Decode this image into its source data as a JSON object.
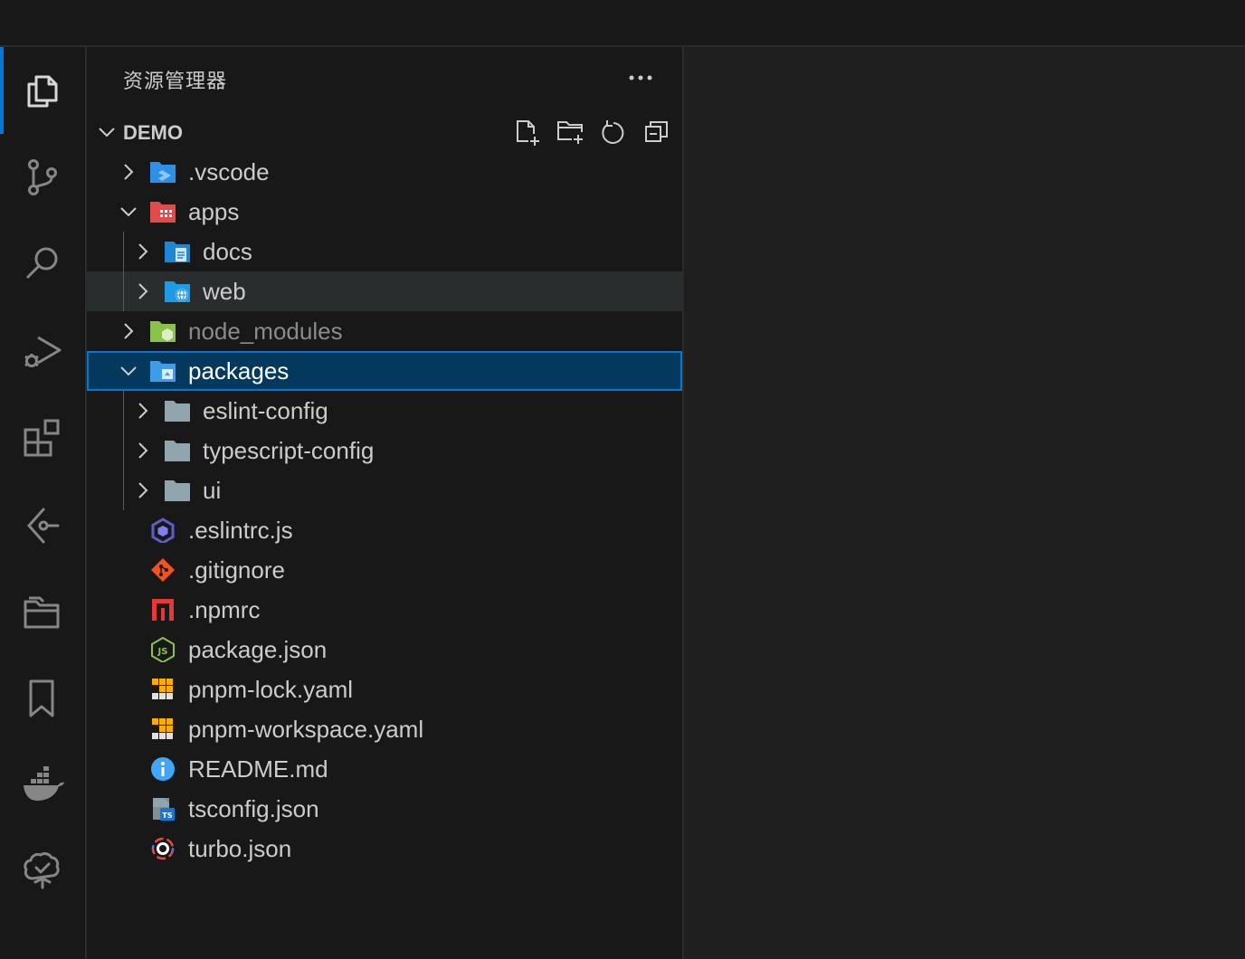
{
  "explorer": {
    "title": "资源管理器",
    "more_actions_icon": "ellipsis-icon",
    "section": {
      "label": "DEMO",
      "actions": [
        "new-file-icon",
        "new-folder-icon",
        "refresh-icon",
        "collapse-all-icon"
      ]
    },
    "tree": [
      {
        "label": ".vscode",
        "type": "folder",
        "expanded": false,
        "depth": 0,
        "icon": "vscode-folder-icon",
        "state": ""
      },
      {
        "label": "apps",
        "type": "folder",
        "expanded": true,
        "depth": 0,
        "icon": "apps-folder-icon",
        "state": ""
      },
      {
        "label": "docs",
        "type": "folder",
        "expanded": false,
        "depth": 1,
        "icon": "docs-folder-icon",
        "state": ""
      },
      {
        "label": "web",
        "type": "folder",
        "expanded": false,
        "depth": 1,
        "icon": "web-folder-icon",
        "state": "hover"
      },
      {
        "label": "node_modules",
        "type": "folder",
        "expanded": false,
        "depth": 0,
        "icon": "node-modules-folder-icon",
        "state": "dimmed"
      },
      {
        "label": "packages",
        "type": "folder",
        "expanded": true,
        "depth": 0,
        "icon": "packages-folder-icon",
        "state": "selected"
      },
      {
        "label": "eslint-config",
        "type": "folder",
        "expanded": false,
        "depth": 1,
        "icon": "folder-icon",
        "state": ""
      },
      {
        "label": "typescript-config",
        "type": "folder",
        "expanded": false,
        "depth": 1,
        "icon": "folder-icon",
        "state": ""
      },
      {
        "label": "ui",
        "type": "folder",
        "expanded": false,
        "depth": 1,
        "icon": "folder-icon",
        "state": ""
      },
      {
        "label": ".eslintrc.js",
        "type": "file",
        "depth": 0,
        "icon": "eslint-icon",
        "state": ""
      },
      {
        "label": ".gitignore",
        "type": "file",
        "depth": 0,
        "icon": "git-icon",
        "state": ""
      },
      {
        "label": ".npmrc",
        "type": "file",
        "depth": 0,
        "icon": "npm-icon",
        "state": ""
      },
      {
        "label": "package.json",
        "type": "file",
        "depth": 0,
        "icon": "nodejs-icon",
        "state": ""
      },
      {
        "label": "pnpm-lock.yaml",
        "type": "file",
        "depth": 0,
        "icon": "pnpm-icon",
        "state": ""
      },
      {
        "label": "pnpm-workspace.yaml",
        "type": "file",
        "depth": 0,
        "icon": "pnpm-icon",
        "state": ""
      },
      {
        "label": "README.md",
        "type": "file",
        "depth": 0,
        "icon": "info-icon",
        "state": ""
      },
      {
        "label": "tsconfig.json",
        "type": "file",
        "depth": 0,
        "icon": "tsconfig-icon",
        "state": ""
      },
      {
        "label": "turbo.json",
        "type": "file",
        "depth": 0,
        "icon": "turbo-icon",
        "state": ""
      }
    ]
  },
  "activity_bar": {
    "items": [
      "explorer-icon",
      "source-control-icon",
      "search-icon",
      "run-debug-icon",
      "extensions-icon",
      "gitlens-icon",
      "project-manager-icon",
      "bookmarks-icon",
      "docker-icon",
      "tree-check-icon"
    ],
    "active": "explorer-icon"
  },
  "colors": {
    "accent": "#0078d4",
    "selection_bg": "#04395e",
    "hover_bg": "#2a2d2e",
    "background": "#181818",
    "editor_bg": "#1f1f1f",
    "text": "#cccccc"
  }
}
